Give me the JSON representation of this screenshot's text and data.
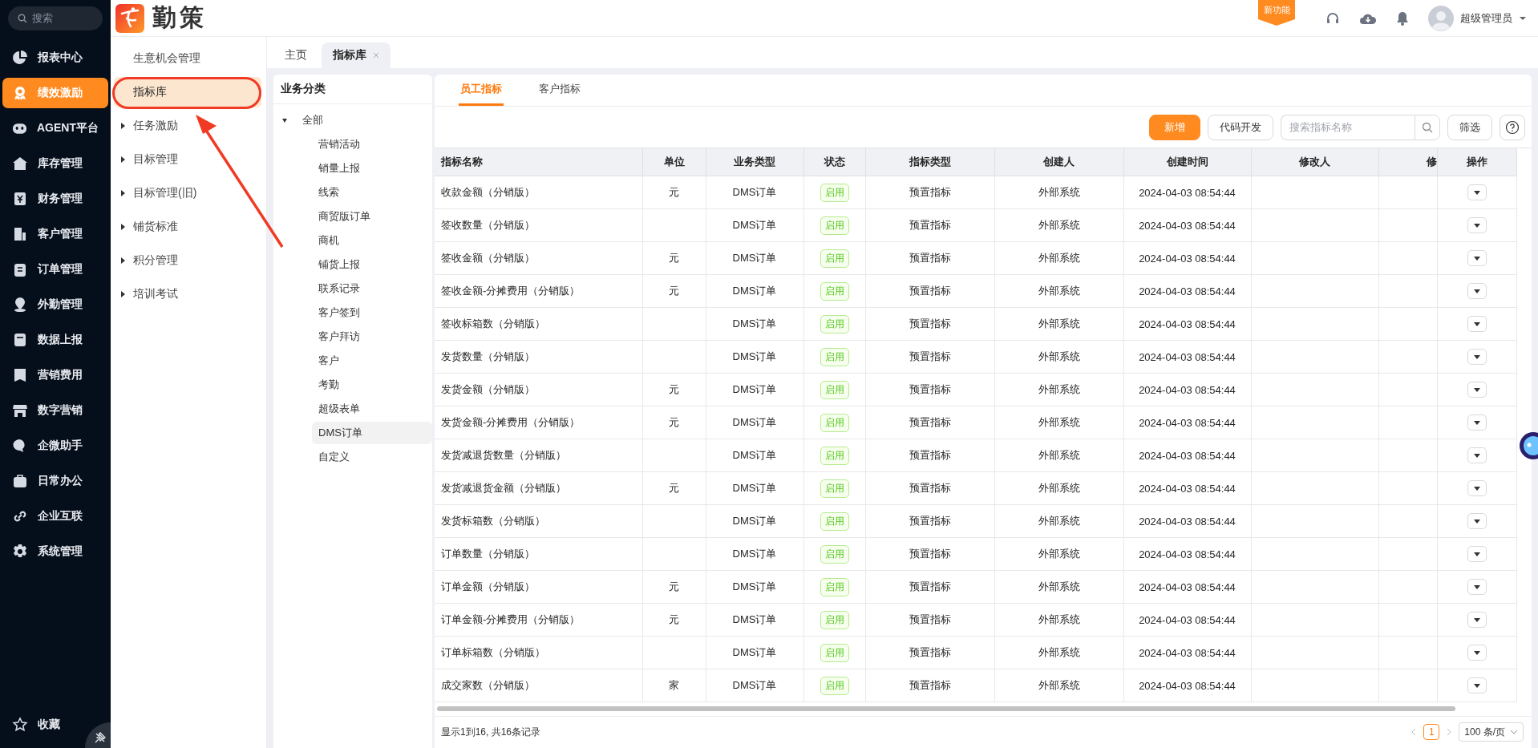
{
  "search": {
    "placeholder": "搜索"
  },
  "nav": [
    {
      "label": "报表中心",
      "selected": false
    },
    {
      "label": "绩效激励",
      "selected": true
    },
    {
      "label": "AGENT平台",
      "selected": false
    },
    {
      "label": "库存管理",
      "selected": false
    },
    {
      "label": "财务管理",
      "selected": false
    },
    {
      "label": "客户管理",
      "selected": false
    },
    {
      "label": "订单管理",
      "selected": false
    },
    {
      "label": "外勤管理",
      "selected": false
    },
    {
      "label": "数据上报",
      "selected": false
    },
    {
      "label": "营销费用",
      "selected": false
    },
    {
      "label": "数字营销",
      "selected": false
    },
    {
      "label": "企微助手",
      "selected": false
    },
    {
      "label": "日常办公",
      "selected": false
    },
    {
      "label": "企业互联",
      "selected": false
    },
    {
      "label": "系统管理",
      "selected": false
    }
  ],
  "favorites": "收藏",
  "logo_text": "勤策",
  "header": {
    "new_feature_badge": "新功能",
    "user_name": "超级管理员"
  },
  "subnav": [
    {
      "label": "生意机会管理",
      "selected": false,
      "expandable": false
    },
    {
      "label": "指标库",
      "selected": true,
      "expandable": false
    },
    {
      "label": "任务激励",
      "selected": false,
      "expandable": true
    },
    {
      "label": "目标管理",
      "selected": false,
      "expandable": true
    },
    {
      "label": "目标管理(旧)",
      "selected": false,
      "expandable": true
    },
    {
      "label": "铺货标准",
      "selected": false,
      "expandable": true
    },
    {
      "label": "积分管理",
      "selected": false,
      "expandable": true
    },
    {
      "label": "培训考试",
      "selected": false,
      "expandable": true
    }
  ],
  "page_tabs": [
    {
      "label": "主页",
      "selected": false,
      "closable": false
    },
    {
      "label": "指标库",
      "selected": true,
      "closable": true
    }
  ],
  "category": {
    "title": "业务分类",
    "tree": [
      {
        "label": "全部",
        "expanded": true,
        "selected": false,
        "children": [
          {
            "label": "营销活动",
            "selected": false
          },
          {
            "label": "销量上报",
            "selected": false
          },
          {
            "label": "线索",
            "selected": false
          },
          {
            "label": "商贸版订单",
            "selected": false
          },
          {
            "label": "商机",
            "selected": false
          },
          {
            "label": "铺货上报",
            "selected": false
          },
          {
            "label": "联系记录",
            "selected": false
          },
          {
            "label": "客户签到",
            "selected": false
          },
          {
            "label": "客户拜访",
            "selected": false
          },
          {
            "label": "客户",
            "selected": false
          },
          {
            "label": "考勤",
            "selected": false
          },
          {
            "label": "超级表单",
            "selected": false
          },
          {
            "label": "DMS订单",
            "selected": true
          },
          {
            "label": "自定义",
            "selected": false
          }
        ]
      }
    ]
  },
  "metric_tabs": [
    {
      "label": "员工指标",
      "selected": true
    },
    {
      "label": "客户指标",
      "selected": false
    }
  ],
  "toolbar": {
    "add": "新增",
    "code_dev": "代码开发",
    "search_placeholder": "搜索指标名称",
    "filter": "筛选"
  },
  "table": {
    "columns": [
      "指标名称",
      "单位",
      "业务类型",
      "状态",
      "指标类型",
      "创建人",
      "创建时间",
      "修改人",
      "修",
      "操作"
    ],
    "rows": [
      {
        "name": "收款金额（分销版）",
        "unit": "元",
        "business_type": "DMS订单",
        "status": "启用",
        "enabled": true,
        "metric_type": "预置指标",
        "creator": "外部系统",
        "created_at": "2024-04-03 08:54:44"
      },
      {
        "name": "签收数量（分销版）",
        "business_type": "DMS订单",
        "status": "启用",
        "enabled": true,
        "metric_type": "预置指标",
        "creator": "外部系统",
        "created_at": "2024-04-03 08:54:44"
      },
      {
        "name": "签收金额（分销版）",
        "unit": "元",
        "business_type": "DMS订单",
        "status": "启用",
        "enabled": true,
        "metric_type": "预置指标",
        "creator": "外部系统",
        "created_at": "2024-04-03 08:54:44"
      },
      {
        "name": "签收金额-分摊费用（分销版）",
        "unit": "元",
        "business_type": "DMS订单",
        "status": "启用",
        "enabled": true,
        "metric_type": "预置指标",
        "creator": "外部系统",
        "created_at": "2024-04-03 08:54:44"
      },
      {
        "name": "签收标箱数（分销版）",
        "business_type": "DMS订单",
        "status": "启用",
        "enabled": true,
        "metric_type": "预置指标",
        "creator": "外部系统",
        "created_at": "2024-04-03 08:54:44"
      },
      {
        "name": "发货数量（分销版）",
        "business_type": "DMS订单",
        "status": "启用",
        "enabled": true,
        "metric_type": "预置指标",
        "creator": "外部系统",
        "created_at": "2024-04-03 08:54:44"
      },
      {
        "name": "发货金额（分销版）",
        "unit": "元",
        "business_type": "DMS订单",
        "status": "启用",
        "enabled": true,
        "metric_type": "预置指标",
        "creator": "外部系统",
        "created_at": "2024-04-03 08:54:44"
      },
      {
        "name": "发货金额-分摊费用（分销版）",
        "unit": "元",
        "business_type": "DMS订单",
        "status": "启用",
        "enabled": true,
        "metric_type": "预置指标",
        "creator": "外部系统",
        "created_at": "2024-04-03 08:54:44"
      },
      {
        "name": "发货减退货数量（分销版）",
        "business_type": "DMS订单",
        "status": "启用",
        "enabled": true,
        "metric_type": "预置指标",
        "creator": "外部系统",
        "created_at": "2024-04-03 08:54:44"
      },
      {
        "name": "发货减退货金额（分销版）",
        "unit": "元",
        "business_type": "DMS订单",
        "status": "启用",
        "enabled": true,
        "metric_type": "预置指标",
        "creator": "外部系统",
        "created_at": "2024-04-03 08:54:44"
      },
      {
        "name": "发货标箱数（分销版）",
        "business_type": "DMS订单",
        "status": "启用",
        "enabled": true,
        "metric_type": "预置指标",
        "creator": "外部系统",
        "created_at": "2024-04-03 08:54:44"
      },
      {
        "name": "订单数量（分销版）",
        "business_type": "DMS订单",
        "status": "启用",
        "enabled": true,
        "metric_type": "预置指标",
        "creator": "外部系统",
        "created_at": "2024-04-03 08:54:44"
      },
      {
        "name": "订单金额（分销版）",
        "unit": "元",
        "business_type": "DMS订单",
        "status": "启用",
        "enabled": true,
        "metric_type": "预置指标",
        "creator": "外部系统",
        "created_at": "2024-04-03 08:54:44"
      },
      {
        "name": "订单金额-分摊费用（分销版）",
        "unit": "元",
        "business_type": "DMS订单",
        "status": "启用",
        "enabled": true,
        "metric_type": "预置指标",
        "creator": "外部系统",
        "created_at": "2024-04-03 08:54:44"
      },
      {
        "name": "订单标箱数（分销版）",
        "business_type": "DMS订单",
        "status": "启用",
        "enabled": true,
        "metric_type": "预置指标",
        "creator": "外部系统",
        "created_at": "2024-04-03 08:54:44"
      },
      {
        "name": "成交家数（分销版）",
        "unit": "家",
        "business_type": "DMS订单",
        "status": "启用",
        "enabled": true,
        "metric_type": "预置指标",
        "creator": "外部系统",
        "created_at": "2024-04-03 08:54:44"
      }
    ]
  },
  "footer": {
    "summary": "显示1到16, 共16条记录",
    "pages": [
      {
        "label": "1",
        "selected": true
      }
    ],
    "page_size": "100 条/页"
  }
}
